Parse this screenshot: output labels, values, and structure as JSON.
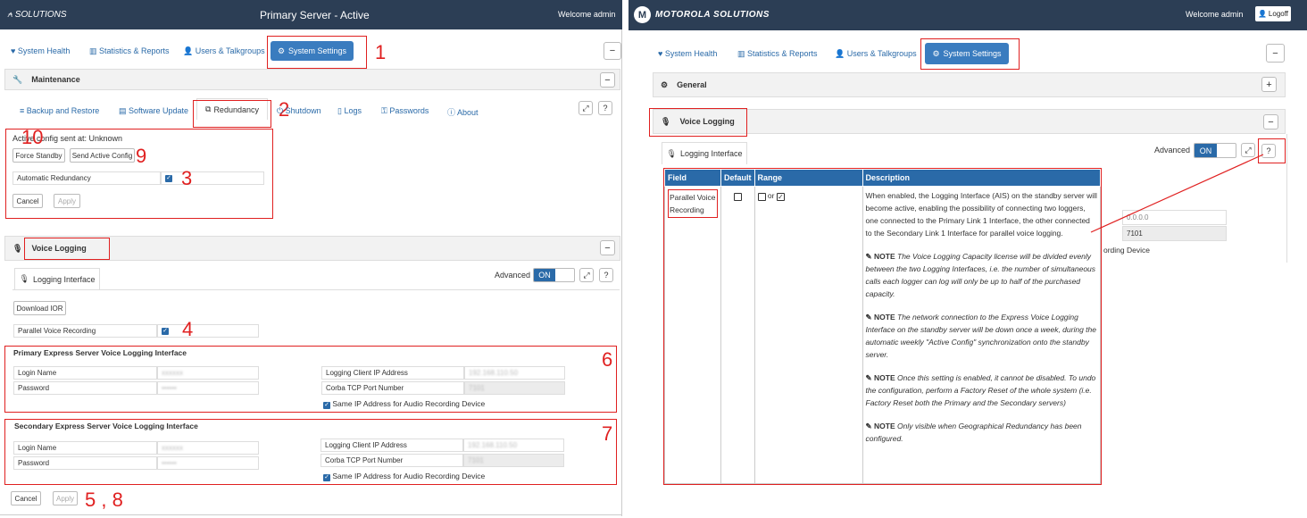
{
  "left": {
    "brand": "SOLUTIONS",
    "title": "Primary Server - Active",
    "welcome": "Welcome admin",
    "nav": [
      "System Health",
      "Statistics & Reports",
      "Users & Talkgroups",
      "System Settings"
    ],
    "maintenance": "Maintenance",
    "subtabs": [
      "Backup and Restore",
      "Software Update",
      "Redundancy",
      "Shutdown",
      "Logs",
      "Passwords",
      "About"
    ],
    "active_config": "Active config sent at: Unknown",
    "force_standby": "Force Standby",
    "send_active_config": "Send Active Config",
    "auto_redundancy": "Automatic Redundancy",
    "cancel": "Cancel",
    "apply": "Apply",
    "voice_logging": "Voice Logging",
    "logging_interface": "Logging Interface",
    "advanced": "Advanced",
    "on": "ON",
    "download_ior": "Download IOR",
    "parallel": "Parallel Voice Recording",
    "primary_title": "Primary Express Server Voice Logging Interface",
    "secondary_title": "Secondary Express Server Voice Logging Interface",
    "login_name": "Login Name",
    "password": "Password",
    "login_name_value": "xxxxxx",
    "password_value": "••••••",
    "client_ip": "Logging Client IP Address",
    "client_ip_value": "192.168.110.50",
    "corba": "Corba TCP Port Number",
    "corba_value": "7101",
    "same_ip": "Same IP Address for Audio Recording Device"
  },
  "right": {
    "brand": "MOTOROLA SOLUTIONS",
    "welcome": "Welcome admin",
    "logoff": "Logoff",
    "nav": [
      "System Health",
      "Statistics & Reports",
      "Users & Talkgroups",
      "System Settings"
    ],
    "general": "General",
    "voice_logging": "Voice Logging",
    "logging_interface": "Logging Interface",
    "advanced": "Advanced",
    "on": "ON",
    "bg_ip": "0.0.0.0",
    "bg_port": "7101",
    "bg_device": "ording Device",
    "table_headers": [
      "Field",
      "Default",
      "Range",
      "Description"
    ],
    "field": "Parallel Voice Recording",
    "range_or": "or",
    "desc_main": "When enabled, the Logging Interface (AIS) on the standby server will become active, enabling the possibility of connecting two loggers, one connected to the Primary Link 1 Interface, the other connected to the Secondary Link 1 Interface for parallel voice logging.",
    "note_label": "NOTE",
    "note1": "The Voice Logging Capacity license will be divided evenly between the two Logging Interfaces, i.e. the number of simultaneous calls each logger can log will only be up to half of the purchased capacity.",
    "note2": "The network connection to the Express Voice Logging Interface on the standby server will be down once a week, during the automatic weekly \"Active Config\" synchronization onto the standby server.",
    "note3": "Once this setting is enabled, it cannot be disabled. To undo the configuration, perform a Factory Reset of the whole system (i.e. Factory Reset both the Primary and the Secondary servers)",
    "note4": "Only visible when Geographical Redundancy has been configured."
  },
  "annotations": [
    "1",
    "2",
    "3",
    "4",
    "6",
    "7",
    "5 , 8",
    "9",
    "10"
  ]
}
